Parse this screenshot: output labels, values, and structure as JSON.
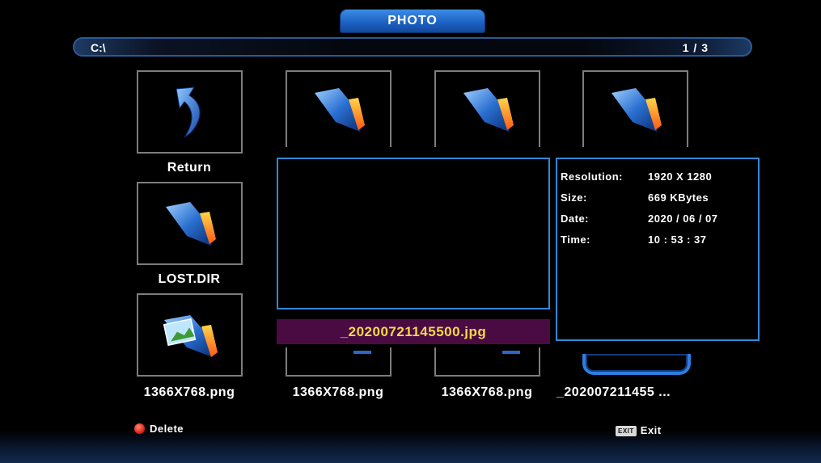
{
  "header": {
    "title": "PHOTO"
  },
  "path_bar": {
    "path": "C:\\",
    "page": "1 / 3"
  },
  "grid": {
    "return": {
      "label": "Return",
      "icon": "return-arrow-icon"
    },
    "lost_dir": {
      "label": "LOST.DIR",
      "icon": "folder-icon"
    },
    "image_1": {
      "label": "1366X768.png",
      "icon": "photo-folder-icon"
    },
    "top_folders": [
      {
        "icon": "folder-icon"
      },
      {
        "icon": "folder-icon"
      },
      {
        "icon": "folder-icon"
      }
    ],
    "bottom_row": [
      {
        "label": "1366X768.png"
      },
      {
        "label": "1366X768.png"
      },
      {
        "label": "_202007211455 ..."
      }
    ]
  },
  "preview": {
    "filename": "_20200721145500.jpg"
  },
  "info": {
    "rows": [
      {
        "key": "Resolution:",
        "value": "1920 X 1280"
      },
      {
        "key": "Size:",
        "value": "669 KBytes"
      },
      {
        "key": "Date:",
        "value": "2020 / 06 / 07"
      },
      {
        "key": "Time:",
        "value": "10 : 53 : 37"
      }
    ]
  },
  "footer": {
    "delete_label": "Delete",
    "exit_key": "EXIT",
    "exit_label": "Exit"
  },
  "colors": {
    "accent": "#2e8ad8",
    "filename_bg": "#4a0b43",
    "filename_text": "#f4d94a"
  }
}
